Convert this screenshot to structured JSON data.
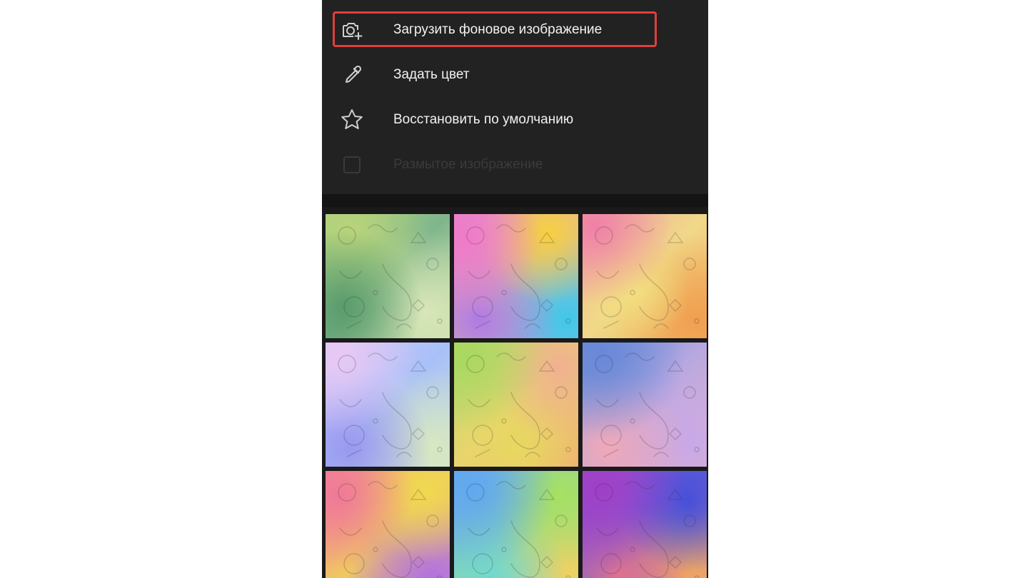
{
  "menu": {
    "items": [
      {
        "label": "Загрузить фоновое изображение",
        "icon": "camera-add-icon",
        "highlighted": true,
        "enabled": true
      },
      {
        "label": "Задать цвет",
        "icon": "eyedropper-icon",
        "highlighted": false,
        "enabled": true
      },
      {
        "label": "Восстановить по умолчанию",
        "icon": "star-icon",
        "highlighted": false,
        "enabled": true
      },
      {
        "label": "Размытое изображение",
        "icon": "checkbox-icon",
        "highlighted": false,
        "enabled": false,
        "checked": false
      }
    ]
  },
  "colors": {
    "highlight_border": "#e0403c",
    "menu_background": "#222222",
    "menu_text": "#f2f2f2",
    "disabled_text": "#3b3b3b"
  },
  "wallpapers": [
    {
      "name": "wallpaper-green-yellow"
    },
    {
      "name": "wallpaper-pink-yellow-cyan"
    },
    {
      "name": "wallpaper-yellow-orange"
    },
    {
      "name": "wallpaper-lavender-blue"
    },
    {
      "name": "wallpaper-green-yellow-orange"
    },
    {
      "name": "wallpaper-blue-pink"
    },
    {
      "name": "wallpaper-pink-yellow-purple"
    },
    {
      "name": "wallpaper-blue-green-yellow"
    },
    {
      "name": "wallpaper-purple-blue-orange"
    }
  ]
}
